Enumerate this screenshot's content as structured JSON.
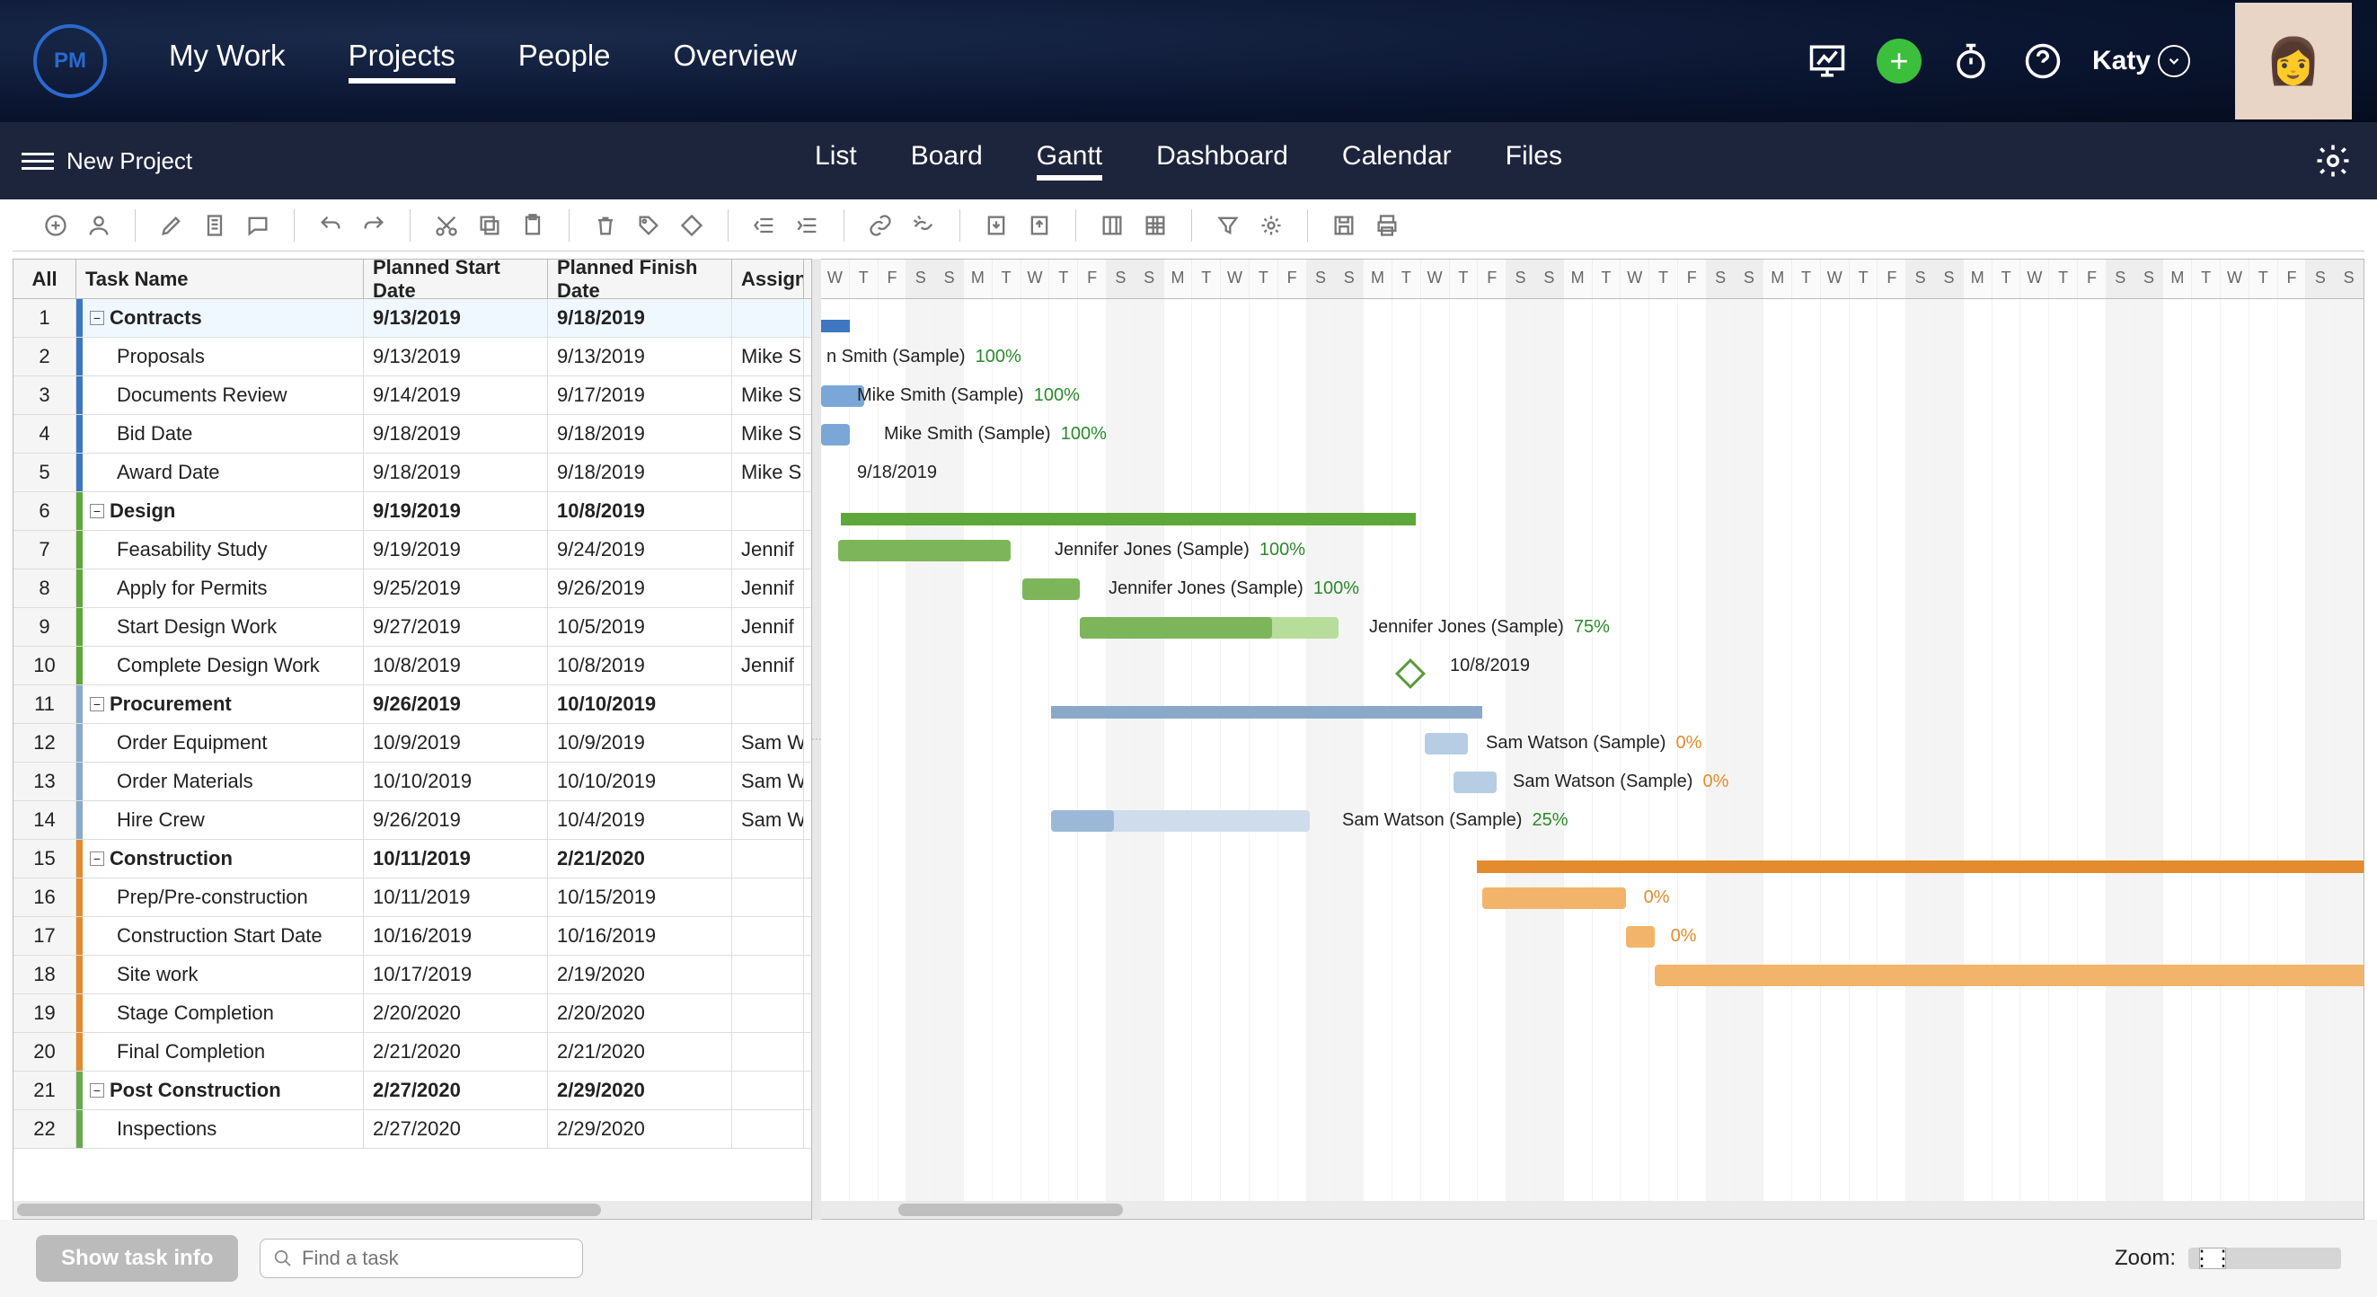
{
  "header": {
    "logo_text": "PM",
    "nav": [
      "My Work",
      "Projects",
      "People",
      "Overview"
    ],
    "nav_active": 1,
    "user": "Katy"
  },
  "subheader": {
    "title": "New Project",
    "tabs": [
      "List",
      "Board",
      "Gantt",
      "Dashboard",
      "Calendar",
      "Files"
    ],
    "tabs_active": 2
  },
  "columns": {
    "all": "All",
    "name": "Task Name",
    "start": "Planned Start Date",
    "finish": "Planned Finish Date",
    "assigned": "Assigned"
  },
  "colors": {
    "contracts": "#3d77c2",
    "design": "#5ea73a",
    "procurement": "#8aa9c8",
    "construction": "#e38b2d",
    "post": "#6aa84f"
  },
  "rows": [
    {
      "n": 1,
      "group": true,
      "indent": 0,
      "name": "Contracts",
      "start": "9/13/2019",
      "finish": "9/18/2019",
      "assigned": "",
      "color": "contracts"
    },
    {
      "n": 2,
      "indent": 1,
      "name": "Proposals",
      "start": "9/13/2019",
      "finish": "9/13/2019",
      "assigned": "Mike S",
      "color": "contracts"
    },
    {
      "n": 3,
      "indent": 1,
      "name": "Documents Review",
      "start": "9/14/2019",
      "finish": "9/17/2019",
      "assigned": "Mike S",
      "color": "contracts"
    },
    {
      "n": 4,
      "indent": 1,
      "name": "Bid Date",
      "start": "9/18/2019",
      "finish": "9/18/2019",
      "assigned": "Mike S",
      "color": "contracts"
    },
    {
      "n": 5,
      "indent": 1,
      "name": "Award Date",
      "start": "9/18/2019",
      "finish": "9/18/2019",
      "assigned": "Mike S",
      "color": "contracts"
    },
    {
      "n": 6,
      "group": true,
      "indent": 0,
      "name": "Design",
      "start": "9/19/2019",
      "finish": "10/8/2019",
      "assigned": "",
      "color": "design"
    },
    {
      "n": 7,
      "indent": 1,
      "name": "Feasability Study",
      "start": "9/19/2019",
      "finish": "9/24/2019",
      "assigned": "Jennif",
      "color": "design"
    },
    {
      "n": 8,
      "indent": 1,
      "name": "Apply for Permits",
      "start": "9/25/2019",
      "finish": "9/26/2019",
      "assigned": "Jennif",
      "color": "design"
    },
    {
      "n": 9,
      "indent": 1,
      "name": "Start Design Work",
      "start": "9/27/2019",
      "finish": "10/5/2019",
      "assigned": "Jennif",
      "color": "design"
    },
    {
      "n": 10,
      "indent": 1,
      "name": "Complete Design Work",
      "start": "10/8/2019",
      "finish": "10/8/2019",
      "assigned": "Jennif",
      "color": "design"
    },
    {
      "n": 11,
      "group": true,
      "indent": 0,
      "name": "Procurement",
      "start": "9/26/2019",
      "finish": "10/10/2019",
      "assigned": "",
      "color": "procurement"
    },
    {
      "n": 12,
      "indent": 1,
      "name": "Order Equipment",
      "start": "10/9/2019",
      "finish": "10/9/2019",
      "assigned": "Sam W",
      "color": "procurement"
    },
    {
      "n": 13,
      "indent": 1,
      "name": "Order Materials",
      "start": "10/10/2019",
      "finish": "10/10/2019",
      "assigned": "Sam W",
      "color": "procurement"
    },
    {
      "n": 14,
      "indent": 1,
      "name": "Hire Crew",
      "start": "9/26/2019",
      "finish": "10/4/2019",
      "assigned": "Sam W",
      "color": "procurement"
    },
    {
      "n": 15,
      "group": true,
      "indent": 0,
      "name": "Construction",
      "start": "10/11/2019",
      "finish": "2/21/2020",
      "assigned": "",
      "color": "construction"
    },
    {
      "n": 16,
      "indent": 1,
      "name": "Prep/Pre-construction",
      "start": "10/11/2019",
      "finish": "10/15/2019",
      "assigned": "",
      "color": "construction"
    },
    {
      "n": 17,
      "indent": 1,
      "name": "Construction Start Date",
      "start": "10/16/2019",
      "finish": "10/16/2019",
      "assigned": "",
      "color": "construction"
    },
    {
      "n": 18,
      "indent": 1,
      "name": "Site work",
      "start": "10/17/2019",
      "finish": "2/19/2020",
      "assigned": "",
      "color": "construction"
    },
    {
      "n": 19,
      "indent": 1,
      "name": "Stage Completion",
      "start": "2/20/2020",
      "finish": "2/20/2020",
      "assigned": "",
      "color": "construction"
    },
    {
      "n": 20,
      "indent": 1,
      "name": "Final Completion",
      "start": "2/21/2020",
      "finish": "2/21/2020",
      "assigned": "",
      "color": "construction"
    },
    {
      "n": 21,
      "group": true,
      "indent": 0,
      "name": "Post Construction",
      "start": "2/27/2020",
      "finish": "2/29/2020",
      "assigned": "",
      "color": "post"
    },
    {
      "n": 22,
      "indent": 1,
      "name": "Inspections",
      "start": "2/27/2020",
      "finish": "2/29/2020",
      "assigned": "",
      "color": "post"
    }
  ],
  "gantt_days": [
    "W",
    "T",
    "F",
    "S",
    "S",
    "M",
    "T",
    "W",
    "T",
    "F",
    "S",
    "S",
    "M",
    "T",
    "W",
    "T",
    "F",
    "S",
    "S",
    "M",
    "T",
    "W",
    "T",
    "F",
    "S",
    "S",
    "M",
    "T",
    "W",
    "T",
    "F",
    "S",
    "S",
    "M",
    "T",
    "W",
    "T",
    "F",
    "S",
    "S",
    "M",
    "T",
    "W",
    "T",
    "F",
    "S",
    "S",
    "M",
    "T",
    "W",
    "T",
    "F",
    "S",
    "S"
  ],
  "gantt_labels": {
    "r2": {
      "text": "n Smith (Sample)",
      "pct": "100%"
    },
    "r3": {
      "text": "Mike Smith (Sample)",
      "pct": "100%"
    },
    "r4": {
      "text": "Mike Smith (Sample)",
      "pct": "100%"
    },
    "r5": {
      "text": "9/18/2019"
    },
    "r7": {
      "text": "Jennifer Jones (Sample)",
      "pct": "100%"
    },
    "r8": {
      "text": "Jennifer Jones (Sample)",
      "pct": "100%"
    },
    "r9": {
      "text": "Jennifer Jones (Sample)",
      "pct": "75%"
    },
    "r10": {
      "text": "10/8/2019"
    },
    "r12": {
      "text": "Sam Watson (Sample)",
      "pct": "0%"
    },
    "r13": {
      "text": "Sam Watson (Sample)",
      "pct": "0%"
    },
    "r14": {
      "text": "Sam Watson (Sample)",
      "pct": "25%"
    },
    "r16": {
      "pct": "0%"
    },
    "r17": {
      "pct": "0%"
    }
  },
  "footer": {
    "show_task_info": "Show task info",
    "search_placeholder": "Find a task",
    "zoom_label": "Zoom:"
  }
}
